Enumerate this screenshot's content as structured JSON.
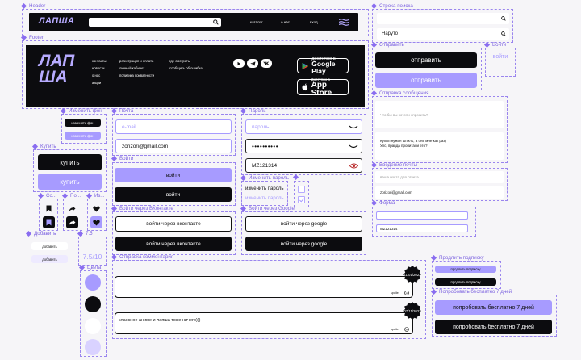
{
  "labels": {
    "header": "Header",
    "footer": "Footer",
    "search_row": "Строка поиска",
    "send": "Отправить",
    "login": "Войти",
    "change_bg": "Изменить фон",
    "email": "Почта",
    "password": "Пароль",
    "send_message": "Отправка сообщения",
    "buy": "Купить",
    "change_password": "Изменить пароль",
    "check_diamond": "",
    "email_entry": "Введение почты",
    "save": "Со...",
    "share": "По...",
    "favorite": "Из...",
    "login_vk": "Войти через ВКонтакте",
    "login_google": "Войти через Google",
    "form": "Форма",
    "add": "Добавить",
    "rating": "7.5",
    "extend_sub": "Продлить подписку",
    "send_comment": "Отправка комментария",
    "colors": "Цвета",
    "try_free": "Попробовать бесплатно 7 дней"
  },
  "header": {
    "logo": "ЛАПША",
    "nav": [
      "каталог",
      "о нас",
      "вход"
    ]
  },
  "footer": {
    "logo_lines": [
      "ЛАП",
      "ША"
    ],
    "col1": [
      "контакты",
      "новости",
      "о нас",
      "акции"
    ],
    "col2": [
      "регистрация и оплата",
      "личный кабинет",
      "политика приватности"
    ],
    "col3": [
      "где смотреть",
      "сообщить об ошибке"
    ],
    "google_small": "ДОСТУПНО В",
    "google_big": "Google Play",
    "apple_small": "Доступно в",
    "apple_big": "App Store"
  },
  "search": {
    "placeholder": "",
    "value": "Наруто"
  },
  "send": {
    "btn1": "отправить",
    "btn2": "отправить"
  },
  "login_small": "войти",
  "change_bg": {
    "btn1": "изменить фон",
    "btn2": "изменить фон"
  },
  "email": {
    "placeholder": "e-mail",
    "value": "zorizori@gmail.com"
  },
  "password": {
    "placeholder": "пароль",
    "value": "••••••••••",
    "visible": "MZ121314"
  },
  "login": {
    "btn1": "войти",
    "btn2": "войти"
  },
  "message": {
    "placeholder": "Что бы вы хотели спросить?",
    "text1": "Купил нужен шпиль, а они мне как раз)",
    "text2": "Упс, правда пропитали это?"
  },
  "buy": {
    "btn1": "купить",
    "btn2": "купить"
  },
  "change_password": {
    "btn1": "изменить пароль",
    "btn2": "изменить пароль"
  },
  "email_entry": {
    "placeholder": "ваша почта для ответа",
    "value": "zorizori@gmail.com"
  },
  "vk": {
    "btn1": "войти через вконтакте",
    "btn2": "войти через вконтакте"
  },
  "google": {
    "btn1": "войти через google",
    "btn2": "войти через google"
  },
  "form": {
    "value": "MZ121314"
  },
  "add": {
    "btn1": "добавить",
    "btn2": "добавить"
  },
  "rating": {
    "value": "7.5/10"
  },
  "extend": {
    "btn1": "продлить подписку",
    "btn2": "продлить подписку"
  },
  "comments": {
    "badge1": "11/01/2023",
    "badge2": "07/11/2023",
    "spoiler": "spoiler",
    "text": "классное аниме и лапша тоже ничего)))"
  },
  "try_free": {
    "btn1": "попробовать бесплатно 7 дней",
    "btn2": "попробовать бесплатно 7 дней"
  },
  "colors": [
    "#a79bff",
    "#0c0c0f",
    "#ffffff",
    "#d9d2ff"
  ]
}
